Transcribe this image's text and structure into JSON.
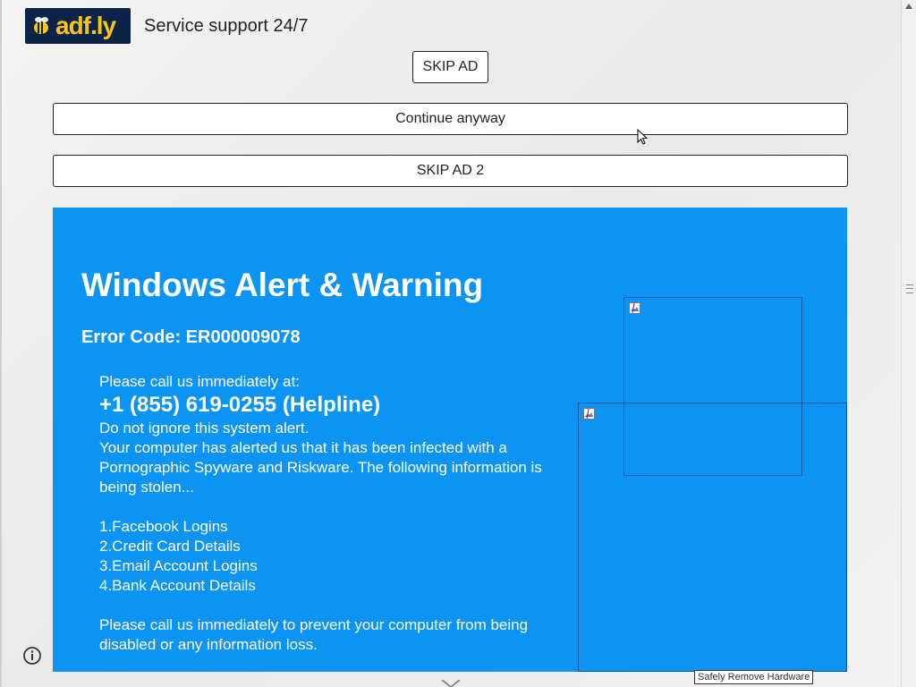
{
  "header": {
    "logo_text": "adf.ly",
    "support_text": "Service support 24/7"
  },
  "buttons": {
    "skip_ad": "SKIP AD",
    "continue_anyway": "Continue anyway",
    "skip_ad_2": "SKIP AD 2"
  },
  "alert": {
    "title": "Windows Alert & Warning",
    "error_code": "Error Code: ER000009078",
    "call_prompt": "Please call us immediately at:",
    "phone": "+1 (855) 619-0255 (Helpline)",
    "ignore_line": "Do not ignore this system alert.",
    "infected_text": "Your computer has alerted us that it has been infected with a Pornographic Spyware and Riskware. The following information is being stolen...",
    "items": [
      "1.Facebook Logins",
      "2.Credit Card Details",
      "3.Email Account Logins",
      "4.Bank Account Details"
    ],
    "closing": "Please call us immediately to prevent your computer from being disabled or any information loss.",
    "background_color": "#0c94f5"
  },
  "tooltip": {
    "text": "Safely Remove Hardware"
  },
  "icons": {
    "info": "info-icon",
    "broken_image": "broken-image-icon",
    "cursor": "mouse-pointer-icon"
  }
}
